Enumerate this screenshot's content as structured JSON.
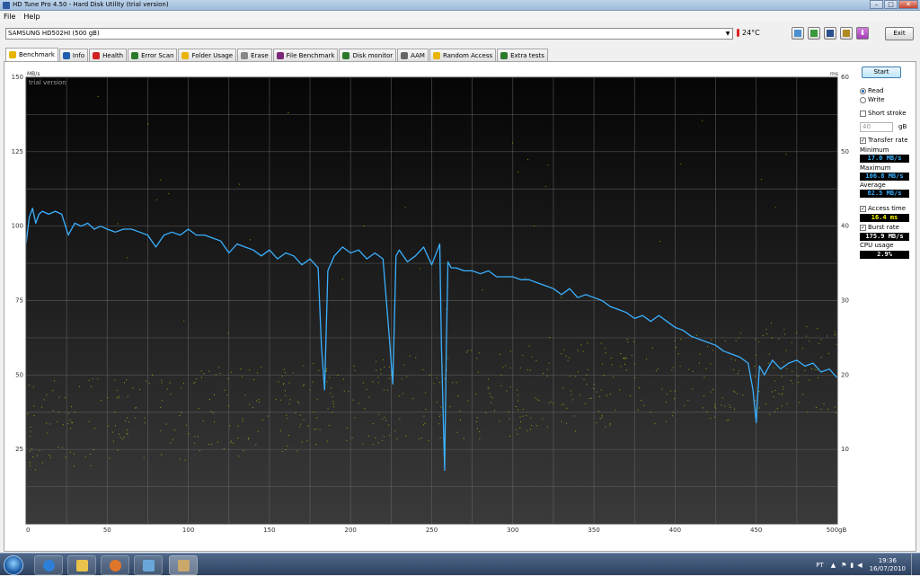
{
  "window": {
    "title": "HD Tune Pro 4.50 - Hard Disk Utility (trial version)",
    "buttons": {
      "minimize": "–",
      "maximize": "□",
      "close": "✕"
    }
  },
  "menu": {
    "items": [
      "File",
      "Help"
    ]
  },
  "toolbar": {
    "drive": "SAMSUNG HD502HI (500 gB)",
    "temperature": "24°C",
    "exit_label": "Exit",
    "icons": [
      "copy-info-icon",
      "copy-screen-icon",
      "save-icon",
      "options-icon",
      "download-icon"
    ]
  },
  "tabs": [
    {
      "label": "Benchmark",
      "icon": "benchmark-icon",
      "color": "#e8b400"
    },
    {
      "label": "Info",
      "icon": "info-icon",
      "color": "#1f5fb0"
    },
    {
      "label": "Health",
      "icon": "health-icon",
      "color": "#d22020"
    },
    {
      "label": "Error Scan",
      "icon": "error-scan-icon",
      "color": "#2a7a2a"
    },
    {
      "label": "Folder Usage",
      "icon": "folder-icon",
      "color": "#e8b400"
    },
    {
      "label": "Erase",
      "icon": "erase-icon",
      "color": "#888888"
    },
    {
      "label": "File Benchmark",
      "icon": "file-benchmark-icon",
      "color": "#7a2a7a"
    },
    {
      "label": "Disk monitor",
      "icon": "disk-monitor-icon",
      "color": "#2a7a2a"
    },
    {
      "label": "AAM",
      "icon": "speaker-icon",
      "color": "#666666"
    },
    {
      "label": "Random Access",
      "icon": "random-access-icon",
      "color": "#e8b400"
    },
    {
      "label": "Extra tests",
      "icon": "extra-tests-icon",
      "color": "#2a7a2a"
    }
  ],
  "side": {
    "start_label": "Start",
    "read_label": "Read",
    "write_label": "Write",
    "short_stroke_label": "Short stroke",
    "short_stroke_value": "40",
    "short_stroke_unit": "gB",
    "transfer_rate_label": "Transfer rate",
    "minimum_label": "Minimum",
    "minimum_value": "17.0 MB/s",
    "maximum_label": "Maximum",
    "maximum_value": "106.8 MB/s",
    "average_label": "Average",
    "average_value": "82.5 MB/s",
    "access_time_label": "Access time",
    "access_time_value": "16.4 ms",
    "burst_rate_label": "Burst rate",
    "burst_rate_value": "175.9 MB/s",
    "cpu_usage_label": "CPU usage",
    "cpu_usage_value": "2.9%",
    "colors": {
      "transfer": "#3ab0ff",
      "access": "#ffff00",
      "burst": "#ffffff"
    }
  },
  "taskbar": {
    "language": "PT",
    "time": "19:36",
    "date": "16/07/2010",
    "apps": [
      "internet-explorer-icon",
      "folder-icon",
      "media-player-icon",
      "network-icon",
      "hdtune-icon"
    ]
  },
  "chart_data": {
    "type": "line",
    "watermark": "trial version",
    "ylabel_left": "MB/s",
    "ylabel_right": "ms",
    "xunit": "gB",
    "xlim": [
      0,
      500
    ],
    "ylim_left": [
      0,
      150
    ],
    "ylim_right": [
      0,
      60
    ],
    "xticks": [
      0,
      50,
      100,
      150,
      200,
      250,
      300,
      350,
      400,
      450,
      500
    ],
    "yticks_left": [
      25,
      50,
      75,
      100,
      125,
      150
    ],
    "yticks_right": [
      10,
      20,
      30,
      40,
      50,
      60
    ],
    "grid": true,
    "series": [
      {
        "name": "Transfer rate",
        "color": "#3ab0ff",
        "x": [
          0,
          2,
          4,
          6,
          8,
          10,
          14,
          18,
          22,
          26,
          30,
          34,
          38,
          42,
          46,
          50,
          55,
          60,
          65,
          70,
          75,
          80,
          85,
          90,
          95,
          100,
          105,
          110,
          115,
          120,
          125,
          130,
          135,
          140,
          145,
          150,
          155,
          160,
          165,
          170,
          175,
          180,
          182,
          184,
          186,
          190,
          195,
          200,
          205,
          210,
          215,
          220,
          224,
          226,
          228,
          230,
          235,
          240,
          245,
          250,
          255,
          256,
          258,
          259,
          260,
          262,
          265,
          270,
          275,
          280,
          285,
          290,
          295,
          300,
          305,
          310,
          315,
          320,
          325,
          330,
          335,
          340,
          345,
          350,
          355,
          360,
          365,
          370,
          375,
          380,
          385,
          390,
          395,
          400,
          405,
          410,
          415,
          420,
          425,
          430,
          435,
          440,
          445,
          448,
          450,
          452,
          455,
          460,
          465,
          470,
          475,
          480,
          485,
          490,
          495,
          500
        ],
        "y": [
          94,
          103,
          106,
          101,
          104,
          105,
          104,
          105,
          104,
          97,
          101,
          100,
          101,
          99,
          100,
          99,
          98,
          99,
          99,
          98,
          97,
          93,
          97,
          98,
          97,
          99,
          97,
          97,
          96,
          95,
          91,
          94,
          93,
          92,
          90,
          92,
          89,
          91,
          90,
          87,
          89,
          86,
          60,
          45,
          85,
          90,
          93,
          91,
          92,
          89,
          91,
          89,
          62,
          47,
          90,
          92,
          88,
          90,
          93,
          87,
          94,
          60,
          18,
          60,
          88,
          86,
          86,
          85,
          85,
          84,
          85,
          83,
          83,
          83,
          82,
          82,
          81,
          80,
          79,
          77,
          79,
          76,
          77,
          76,
          75,
          73,
          72,
          71,
          69,
          70,
          68,
          70,
          68,
          66,
          65,
          63,
          62,
          61,
          60,
          58,
          57,
          56,
          54,
          45,
          34,
          53,
          50,
          55,
          52,
          54,
          55,
          53,
          54,
          51,
          52,
          49
        ]
      }
    ]
  }
}
